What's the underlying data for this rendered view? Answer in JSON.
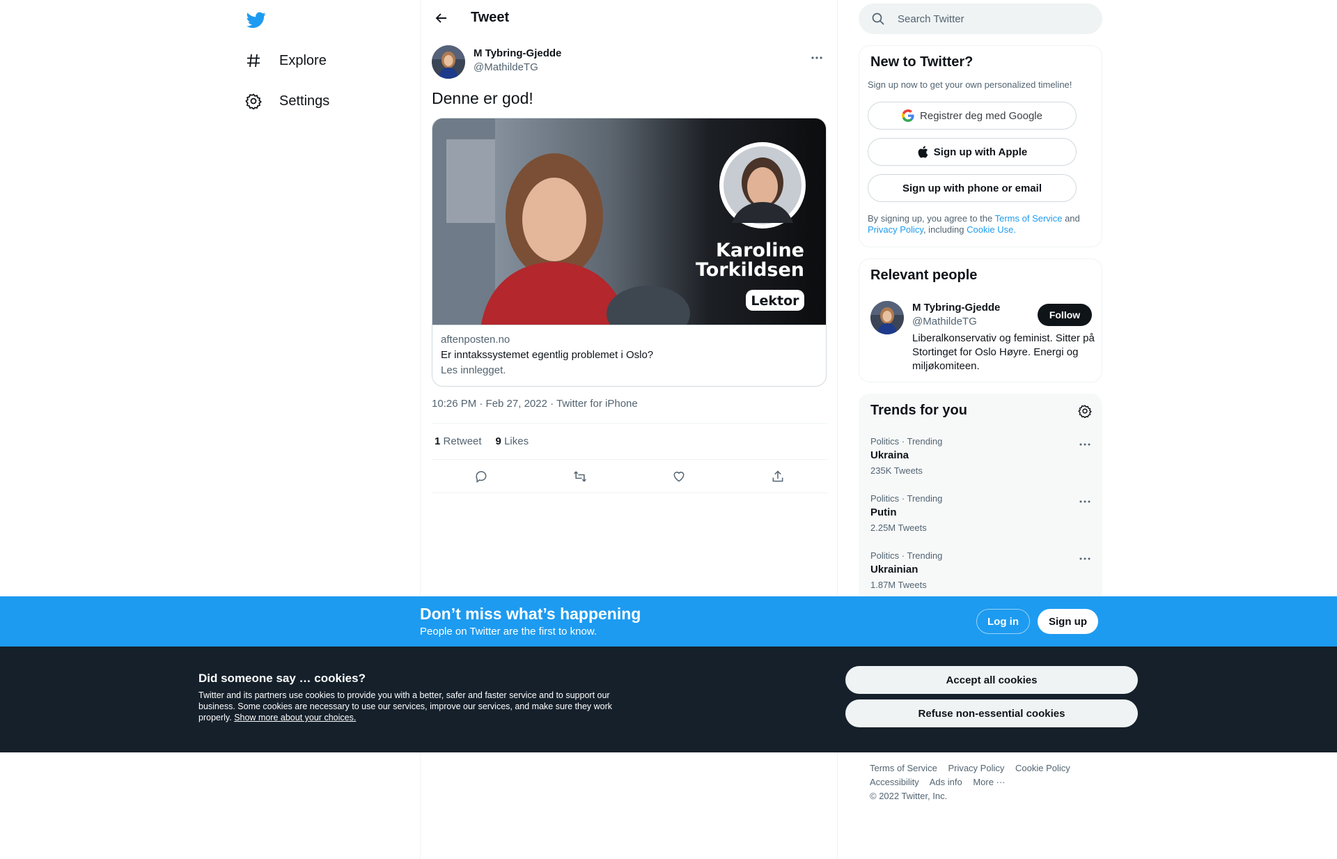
{
  "nav": {
    "logo": "twitter-bird-icon",
    "items": [
      {
        "label": "Explore",
        "icon": "hashtag-icon"
      },
      {
        "label": "Settings",
        "icon": "gear-icon"
      }
    ]
  },
  "header": {
    "title": "Tweet"
  },
  "tweet": {
    "author_name": "M Tybring-Gjedde",
    "author_handle": "@MathildeTG",
    "text": "Denne er god!",
    "card": {
      "image_name": "Karoline Torkildsen",
      "image_name_line1": "Karoline",
      "image_name_line2": "Torkildsen",
      "image_badge": "Lektor",
      "domain": "aftenposten.no",
      "title": "Er inntakssystemet egentlig problemet i Oslo?",
      "description": "Les innlegget."
    },
    "timestamp": "10:26 PM · Feb 27, 2022 · Twitter for iPhone",
    "retweets_count": "1",
    "retweets_label": "Retweet",
    "likes_count": "9",
    "likes_label": "Likes"
  },
  "search": {
    "placeholder": "Search Twitter"
  },
  "new_to_twitter": {
    "title": "New to Twitter?",
    "subtitle": "Sign up now to get your own personalized timeline!",
    "google_label": "Registrer deg med Google",
    "apple_label": "Sign up with Apple",
    "phone_label": "Sign up with phone or email",
    "legal_1": "By signing up, you agree to the",
    "terms": "Terms of Service",
    "and": "and",
    "privacy": "Privacy Policy",
    "including": ", including",
    "cookie_use": "Cookie Use."
  },
  "relevant_people": {
    "title": "Relevant people",
    "name": "M Tybring-Gjedde",
    "handle": "@MathildeTG",
    "bio": "Liberalkonservativ og feminist. Sitter på Stortinget for Oslo Høyre. Energi og miljøkomiteen.",
    "follow_label": "Follow"
  },
  "trends": {
    "title": "Trends for you",
    "items": [
      {
        "context": "Politics · Trending",
        "name": "Ukraina",
        "count": "235K Tweets"
      },
      {
        "context": "Politics · Trending",
        "name": "Putin",
        "count": "2.25M Tweets"
      },
      {
        "context": "Politics · Trending",
        "name": "Ukrainian",
        "count": "1.87M Tweets"
      }
    ]
  },
  "footer": {
    "terms": "Terms of Service",
    "privacy": "Privacy Policy",
    "cookie": "Cookie Policy",
    "accessibility": "Accessibility",
    "ads": "Ads info",
    "more": "More ···",
    "copyright": "© 2022 Twitter, Inc."
  },
  "cta": {
    "title": "Don’t miss what’s happening",
    "subtitle": "People on Twitter are the first to know.",
    "login_label": "Log in",
    "signup_label": "Sign up"
  },
  "cookie_banner": {
    "title": "Did someone say … cookies?",
    "text": "Twitter and its partners use cookies to provide you with a better, safer and faster service and to support our business. Some cookies are necessary to use our services, improve our services, and make sure they work properly.",
    "link": "Show more about your choices.",
    "accept_label": "Accept all cookies",
    "refuse_label": "Refuse non-essential cookies"
  },
  "colors": {
    "brand": "#1d9bf0",
    "text": "#0f1419",
    "secondary": "#536471",
    "cookie_bg": "#15202b"
  }
}
